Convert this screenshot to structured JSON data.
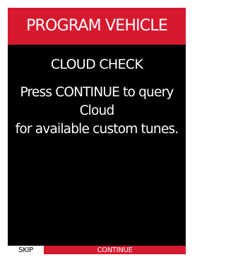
{
  "header": {
    "title": "PROGRAM VEHICLE"
  },
  "screen": {
    "subtitle": "CLOUD CHECK",
    "message_line1": "Press CONTINUE to query Cloud",
    "message_line2": "for available custom tunes."
  },
  "footer": {
    "skip_label": "SKIP",
    "continue_label": "CONTINUE"
  },
  "colors": {
    "accent": "#d7192f",
    "background": "#000000",
    "text": "#ffffff"
  }
}
